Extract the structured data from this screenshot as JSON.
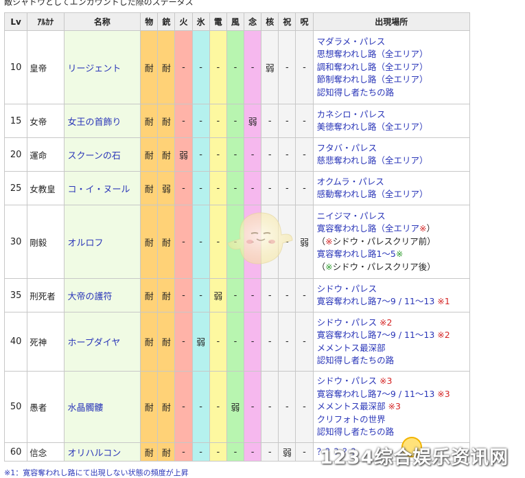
{
  "top_caption": "敵シャドウとしてエンカウントした際のステータス",
  "headers": [
    "Lv",
    "ｱﾙｶﾅ",
    "名称",
    "物",
    "銃",
    "火",
    "氷",
    "電",
    "風",
    "念",
    "核",
    "祝",
    "呪",
    "出現場所"
  ],
  "rows": [
    {
      "lv": "10",
      "arcana": "皇帝",
      "name": "リージェント",
      "res": [
        "耐",
        "耐",
        "-",
        "-",
        "-",
        "-",
        "-",
        "弱",
        "-",
        "-"
      ],
      "locations": [
        [
          "マダラメ・パレス"
        ],
        [
          "思想奪われし路（全エリア）"
        ],
        [
          "調和奪われし路（全エリア）"
        ],
        [
          "節制奪われし路（全エリア）"
        ],
        [
          "認知得し者たちの路"
        ]
      ]
    },
    {
      "lv": "15",
      "arcana": "女帝",
      "name": "女王の首飾り",
      "res": [
        "耐",
        "耐",
        "-",
        "-",
        "-",
        "-",
        "弱",
        "-",
        "-",
        "-"
      ],
      "locations": [
        [
          "カネシロ・パレス"
        ],
        [
          "美徳奪われし路（全エリア）"
        ]
      ]
    },
    {
      "lv": "20",
      "arcana": "運命",
      "name": "スクーンの石",
      "res": [
        "耐",
        "耐",
        "弱",
        "-",
        "-",
        "-",
        "-",
        "-",
        "-",
        "-"
      ],
      "locations": [
        [
          "フタバ・パレス"
        ],
        [
          "慈悲奪われし路（全エリア）"
        ]
      ]
    },
    {
      "lv": "25",
      "arcana": "女教皇",
      "name": "コ・イ・ヌール",
      "res": [
        "耐",
        "弱",
        "-",
        "-",
        "-",
        "-",
        "-",
        "-",
        "-",
        "-"
      ],
      "locations": [
        [
          "オクムラ・パレス"
        ],
        [
          "感動奪われし路（全エリア）"
        ]
      ]
    },
    {
      "lv": "30",
      "arcana": "剛毅",
      "name": "オルロフ",
      "res": [
        "耐",
        "耐",
        "-",
        "-",
        "-",
        "-",
        "-",
        "-",
        "-",
        "弱"
      ],
      "locations": [
        [
          "ニイジマ・パレス"
        ],
        [
          "寛容奪われし路（全エリア",
          "※",
          "）"
        ],
        [
          "（",
          "※",
          "シドウ・パレスクリア前）"
        ],
        [
          "寛容奪われし路1～5",
          "※"
        ],
        [
          "（",
          "※",
          "シドウ・パレスクリア後）"
        ]
      ]
    },
    {
      "lv": "35",
      "arcana": "刑死者",
      "name": "大帝の護符",
      "res": [
        "耐",
        "耐",
        "-",
        "-",
        "弱",
        "-",
        "-",
        "-",
        "-",
        "-"
      ],
      "locations": [
        [
          "シドウ・パレス"
        ],
        [
          "寛容奪われし路7～9 / 11～13 ",
          "※1"
        ]
      ]
    },
    {
      "lv": "40",
      "arcana": "死神",
      "name": "ホープダイヤ",
      "res": [
        "耐",
        "耐",
        "-",
        "弱",
        "-",
        "-",
        "-",
        "-",
        "-",
        "-"
      ],
      "locations": [
        [
          "シドウ・パレス ",
          "※2"
        ],
        [
          "寛容奪われし路7～9 / 11～13 ",
          "※2"
        ],
        [
          "メメントス最深部"
        ],
        [
          "認知得し者たちの路"
        ]
      ]
    },
    {
      "lv": "50",
      "arcana": "愚者",
      "name": "水晶髑髏",
      "res": [
        "耐",
        "耐",
        "-",
        "-",
        "-",
        "弱",
        "-",
        "-",
        "-",
        "-"
      ],
      "locations": [
        [
          "シドウ・パレス ",
          "※3"
        ],
        [
          "寛容奪われし路7～9 / 11～13 ",
          "※3"
        ],
        [
          "メメントス最深部 ",
          "※3"
        ],
        [
          "クリフォトの世界"
        ],
        [
          "認知得し者たちの路"
        ]
      ]
    },
    {
      "lv": "60",
      "arcana": "信念",
      "name": "オリハルコン",
      "res": [
        "耐",
        "耐",
        "-",
        "-",
        "-",
        "-",
        "-",
        "-",
        "弱",
        "-"
      ],
      "locations": [
        [
          "？？？？？"
        ]
      ]
    }
  ],
  "watermark": "1234综合娱乐资讯网",
  "bottom_note": "※1：寛容奪われし路にて出現しない状態の頻度が上昇",
  "colors": {
    "phys": "#ffd277",
    "fire": "#ffb3a8",
    "ice": "#b5f1ee",
    "elec": "#fdf8a0",
    "wind": "#b8f5b0",
    "psy": "#f6b8ee",
    "link": "#2a36b8",
    "note_red": "#d42424",
    "note_green": "#2a9a2a"
  }
}
